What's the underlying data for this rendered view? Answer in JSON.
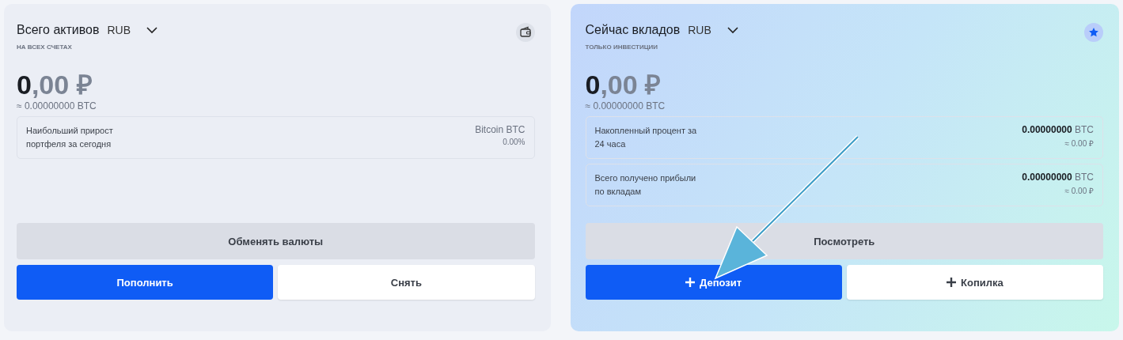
{
  "cards": [
    {
      "kind": "plain",
      "title": "Всего активов",
      "currency": "RUB",
      "subtitle": "НА ВСЕХ СЧЕТАХ",
      "amount_int": "0",
      "amount_frac": ",00 ₽",
      "btc": "≈ 0.00000000 BTC",
      "arrow": false,
      "stats": [
        {
          "label": "Наибольший прирост портфеля за сегодня",
          "value": "Bitcoin",
          "unit": "BTC",
          "sub": "0.00%",
          "value_dark": false
        }
      ],
      "wide_button": {
        "label": "Обменять валюты"
      },
      "buttons": [
        {
          "kind": "primary",
          "label": "Пополнить",
          "plus": false
        },
        {
          "kind": "outline",
          "label": "Снять",
          "plus": false
        }
      ]
    },
    {
      "kind": "gradient",
      "title": "Сейчас вкладов",
      "currency": "RUB",
      "subtitle": "ТОЛЬКО ИНВЕСТИЦИИ",
      "amount_int": "0",
      "amount_frac": ",00 ₽",
      "btc": "≈ 0.00000000 BTC",
      "arrow": true,
      "stats": [
        {
          "label": "Накопленный процент за 24 часа",
          "value": "0.00000000",
          "unit": "BTC",
          "sub": "≈ 0.00 ₽",
          "value_dark": true
        },
        {
          "label": "Всего получено прибыли по вкладам",
          "value": "0.00000000",
          "unit": "BTC",
          "sub": "≈ 0.00 ₽",
          "value_dark": true
        }
      ],
      "wide_button": {
        "label": "Посмотреть"
      },
      "buttons": [
        {
          "kind": "primary",
          "label": "Депозит",
          "plus": true
        },
        {
          "kind": "outline",
          "label": "Копилка",
          "plus": true
        }
      ]
    }
  ]
}
